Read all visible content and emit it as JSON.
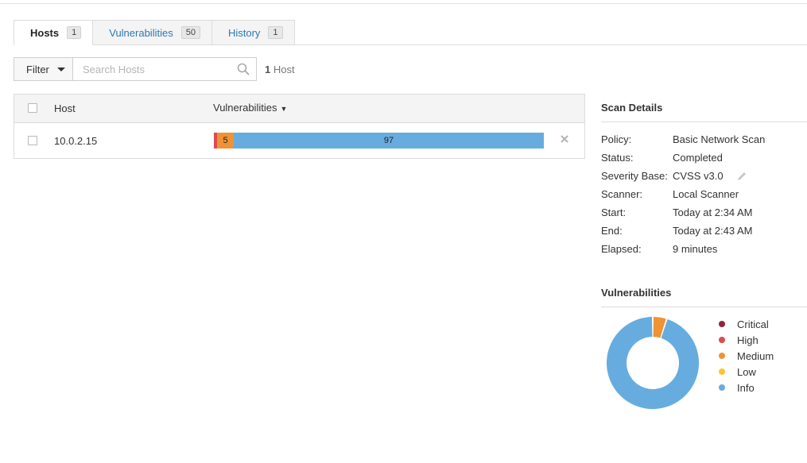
{
  "tabs": [
    {
      "label": "Hosts",
      "count": "1",
      "active": true
    },
    {
      "label": "Vulnerabilities",
      "count": "50",
      "active": false
    },
    {
      "label": "History",
      "count": "1",
      "active": false
    }
  ],
  "filter": {
    "label": "Filter",
    "search_placeholder": "Search Hosts",
    "count_number": "1",
    "count_label": "Host"
  },
  "table": {
    "headers": {
      "host": "Host",
      "vulnerabilities": "Vulnerabilities",
      "sort_indicator": "▼"
    },
    "rows": [
      {
        "host": "10.0.2.15",
        "segments": [
          {
            "severity": "medium",
            "count": 5,
            "label": "5",
            "color": "#ee9336"
          },
          {
            "severity": "info",
            "count": 97,
            "label": "97",
            "color": "#67acdf"
          }
        ]
      }
    ]
  },
  "scan_details": {
    "title": "Scan Details",
    "rows": [
      {
        "key": "Policy:",
        "value": "Basic Network Scan"
      },
      {
        "key": "Status:",
        "value": "Completed"
      },
      {
        "key": "Severity Base:",
        "value": "CVSS v3.0",
        "editable": true
      },
      {
        "key": "Scanner:",
        "value": "Local Scanner"
      },
      {
        "key": "Start:",
        "value": "Today at 2:34 AM"
      },
      {
        "key": "End:",
        "value": "Today at 2:43 AM"
      },
      {
        "key": "Elapsed:",
        "value": "9 minutes"
      }
    ]
  },
  "vulnerabilities_summary": {
    "title": "Vulnerabilities",
    "legend": [
      {
        "label": "Critical",
        "color": "#91243e"
      },
      {
        "label": "High",
        "color": "#dd4b50"
      },
      {
        "label": "Medium",
        "color": "#ee9336"
      },
      {
        "label": "Low",
        "color": "#fdc431"
      },
      {
        "label": "Info",
        "color": "#67acdf"
      }
    ],
    "slices": [
      {
        "label": "Medium",
        "value": 5,
        "color": "#ee9336"
      },
      {
        "label": "Info",
        "value": 97,
        "color": "#67acdf"
      }
    ]
  },
  "colors": {
    "accent": "#2a7ab5",
    "high_edge": "#dd4b50"
  }
}
